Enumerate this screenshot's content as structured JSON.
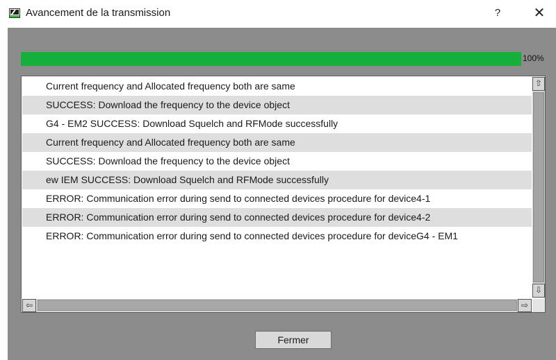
{
  "window": {
    "title": "Avancement de la transmission",
    "help_label": "?",
    "close_label": "✕"
  },
  "progress": {
    "value_percent": 100,
    "label": "100%",
    "color": "#14b03b"
  },
  "log": {
    "rows": [
      "Current frequency and Allocated frequency both are same",
      "SUCCESS: Download the frequency to the device object",
      "G4 - EM2 SUCCESS: Download Squelch and RFMode successfully",
      "Current frequency and Allocated frequency both are same",
      "SUCCESS: Download the frequency to the device object",
      "ew IEM SUCCESS: Download Squelch and RFMode successfully",
      "ERROR: Communication error during send to connected devices procedure for device4-1",
      "ERROR: Communication error during send to connected devices procedure for device4-2",
      "ERROR: Communication error during send to connected devices procedure for deviceG4 - EM1"
    ]
  },
  "scrollbar": {
    "up_icon": "⇧",
    "down_icon": "⇩",
    "left_icon": "⇦",
    "right_icon": "⇨"
  },
  "footer": {
    "close_button_label": "Fermer"
  }
}
